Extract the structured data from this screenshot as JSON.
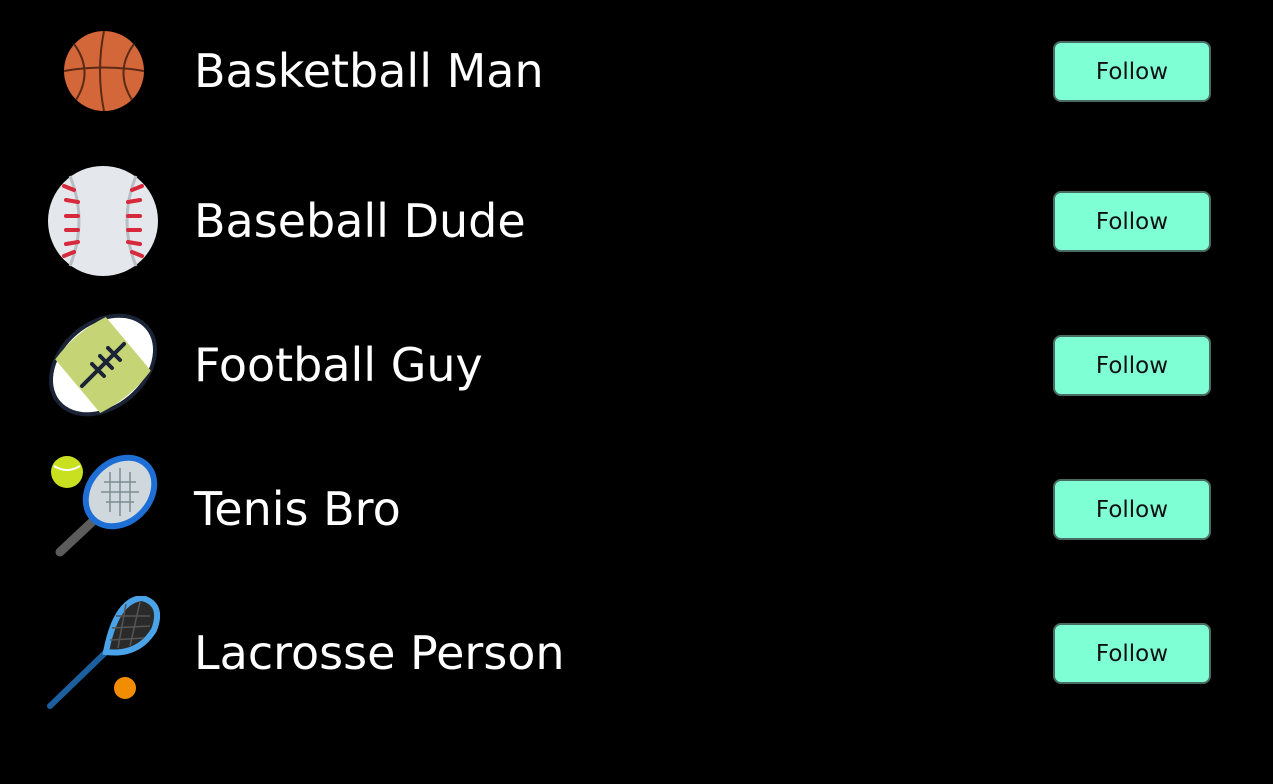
{
  "users": [
    {
      "name": "Basketball Man",
      "icon": "basketball-icon",
      "follow_label": "Follow"
    },
    {
      "name": "Baseball Dude",
      "icon": "baseball-icon",
      "follow_label": "Follow"
    },
    {
      "name": "Football Guy",
      "icon": "football-icon",
      "follow_label": "Follow"
    },
    {
      "name": "Tenis Bro",
      "icon": "tennis-icon",
      "follow_label": "Follow"
    },
    {
      "name": "Lacrosse Person",
      "icon": "lacrosse-icon",
      "follow_label": "Follow"
    }
  ],
  "colors": {
    "background": "#000000",
    "button": "#7fffd4",
    "text": "#ffffff"
  }
}
